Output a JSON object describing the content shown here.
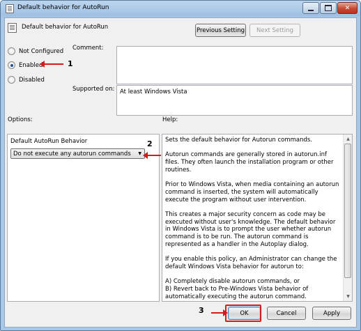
{
  "window": {
    "title": "Default behavior for AutoRun",
    "minimize_icon": "minimize-icon",
    "maximize_icon": "maximize-icon",
    "close_icon": "close-icon"
  },
  "header": {
    "policy_name": "Default behavior for AutoRun",
    "previous_setting": "Previous Setting",
    "next_setting": "Next Setting"
  },
  "state": {
    "options": [
      {
        "label": "Not Configured",
        "checked": false
      },
      {
        "label": "Enabled",
        "checked": true
      },
      {
        "label": "Disabled",
        "checked": false
      }
    ]
  },
  "comment": {
    "label": "Comment:",
    "value": ""
  },
  "supported": {
    "label": "Supported on:",
    "value": "At least Windows Vista"
  },
  "sections": {
    "options_label": "Options:",
    "help_label": "Help:"
  },
  "options_panel": {
    "title": "Default AutoRun Behavior",
    "dropdown_value": "Do not execute any autorun commands"
  },
  "help": {
    "paragraphs": [
      "Sets the default behavior for Autorun commands.",
      "Autorun commands are generally stored in autorun.inf files. They often launch the installation program or other routines.",
      "Prior to Windows Vista, when media containing an autorun command is inserted, the system will automatically execute the program without user intervention.",
      "This creates a major security concern as code may be executed without user's knowledge. The default behavior in Windows Vista is to prompt the user whether autorun command is to be run. The autorun command is represented as a handler in the Autoplay dialog.",
      "If you enable this policy, an Administrator can change the default Windows Vista behavior for autorun to:",
      "A) Completely disable autorun commands, or\nB) Revert back to Pre-Windows Vista behavior of automatically executing the autorun command."
    ]
  },
  "footer": {
    "ok": "OK",
    "cancel": "Cancel",
    "apply": "Apply"
  },
  "annotations": {
    "step1": "1",
    "step2": "2",
    "step3": "3"
  },
  "colors": {
    "annotation_red": "#d7191c"
  }
}
